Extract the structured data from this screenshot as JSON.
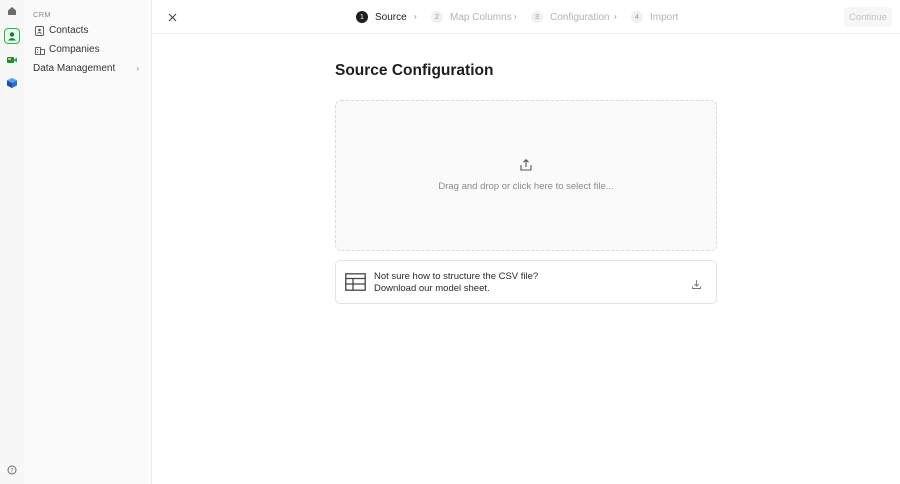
{
  "rail": {
    "icons": [
      "home-icon",
      "crm-icon",
      "video-icon",
      "cube-icon",
      "help-icon"
    ],
    "accent": "#2fb24c"
  },
  "sidebar": {
    "header": "CRM",
    "items": [
      {
        "label": "Contacts",
        "icon": "contact-card-icon"
      },
      {
        "label": "Companies",
        "icon": "building-icon"
      },
      {
        "label": "Data Management",
        "icon": "chevron-right-icon"
      }
    ]
  },
  "stepper": {
    "steps": [
      {
        "number": "1",
        "label": "Source",
        "state": "active"
      },
      {
        "number": "2",
        "label": "Map Columns",
        "state": "inactive"
      },
      {
        "number": "3",
        "label": "Configuration",
        "state": "inactive"
      },
      {
        "number": "4",
        "label": "Import",
        "state": "inactive"
      }
    ]
  },
  "header": {
    "continue_label": "Continue"
  },
  "main": {
    "title": "Source Configuration",
    "dropzone_text": "Drag and drop or click here to select file...",
    "help_line1": "Not sure how to structure the CSV file?",
    "help_line2": "Download our model sheet."
  }
}
